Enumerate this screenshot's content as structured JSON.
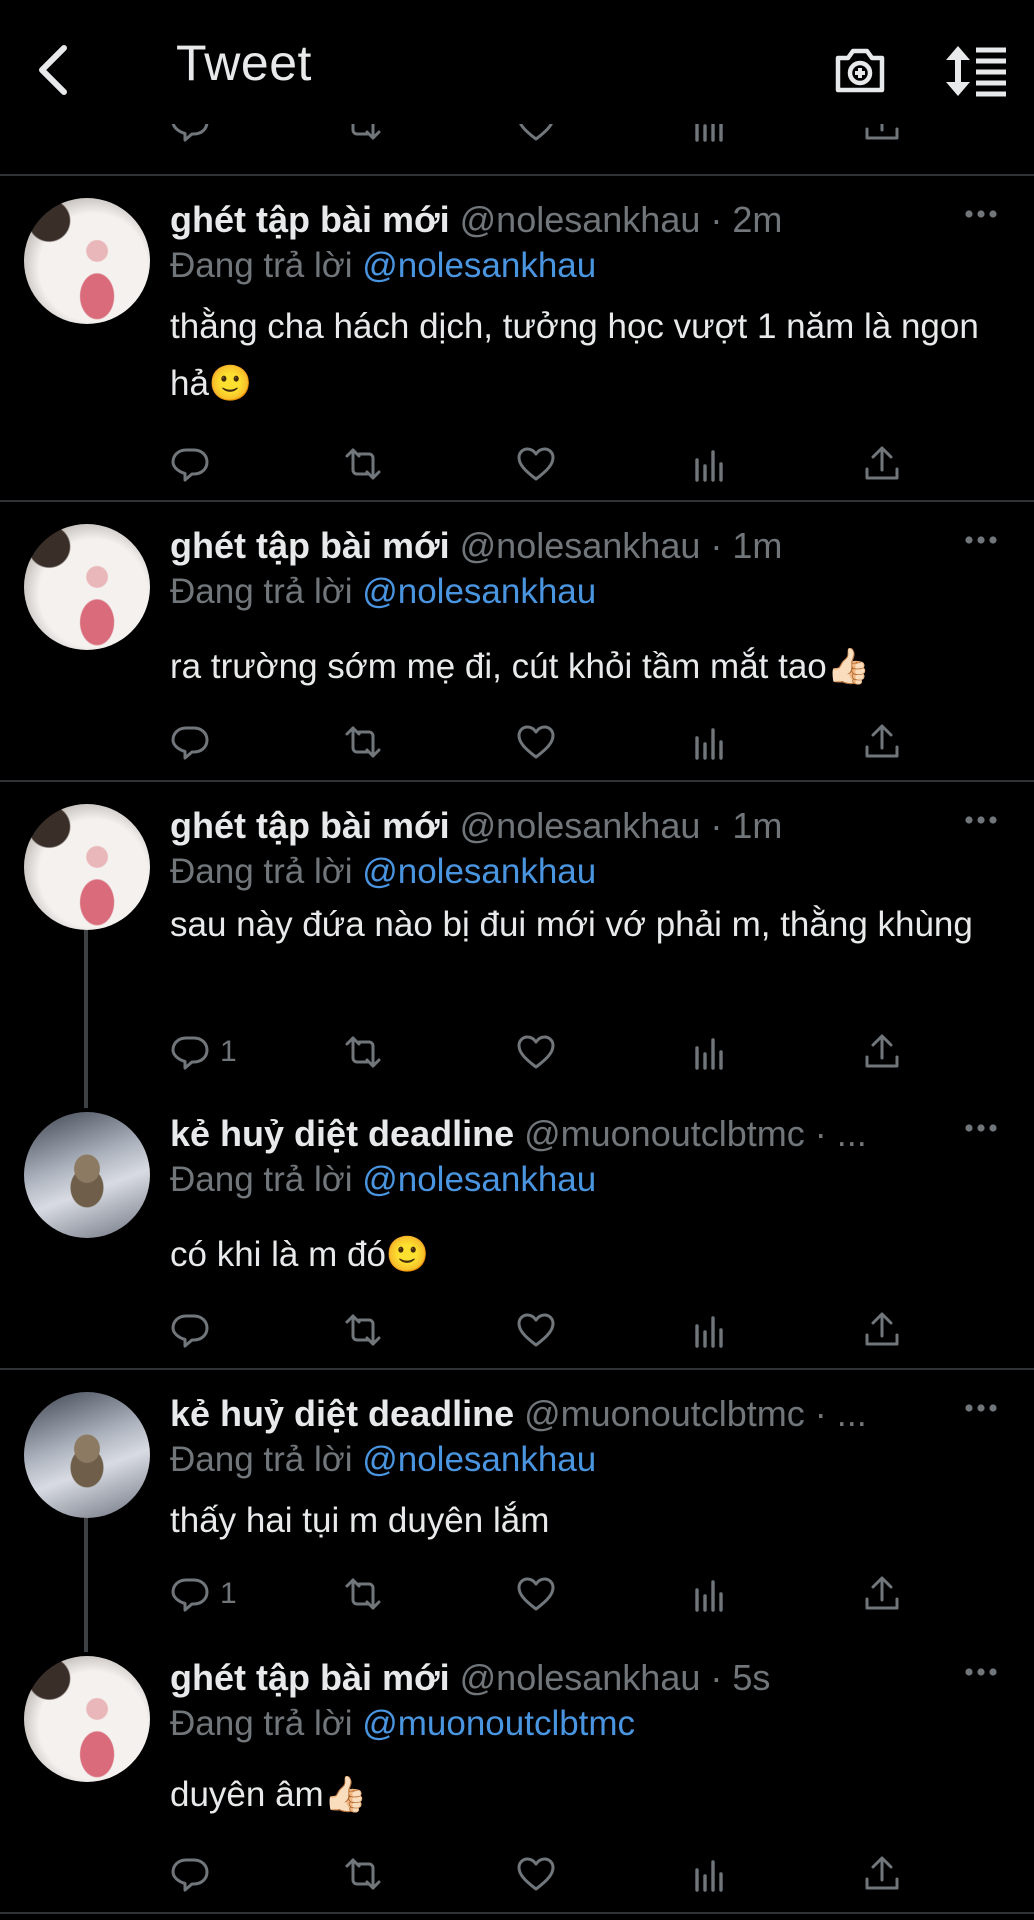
{
  "header": {
    "title": "Tweet"
  },
  "tweets": [
    {
      "name": "ghét tập bài mới",
      "meta": "@nolesankhau · 2m",
      "reply_prefix": "Đang trả lời",
      "reply_to": "@nolesankhau",
      "text": "thằng cha hách dịch, tưởng học vượt 1 năm là ngon hả🙂",
      "reply_count": ""
    },
    {
      "name": "ghét tập bài mới",
      "meta": "@nolesankhau · 1m",
      "reply_prefix": "Đang trả lời",
      "reply_to": "@nolesankhau",
      "text": "ra trường sớm mẹ đi, cút khỏi tầm mắt tao👍🏻",
      "reply_count": ""
    },
    {
      "name": "ghét tập bài mới",
      "meta": "@nolesankhau · 1m",
      "reply_prefix": "Đang trả lời",
      "reply_to": "@nolesankhau",
      "text": "sau này đứa nào bị đui mới vớ phải m, thằng khùng",
      "reply_count": "1"
    },
    {
      "name": "kẻ huỷ diệt deadline",
      "meta": "@muonoutclbtmc · ...",
      "reply_prefix": "Đang trả lời",
      "reply_to": "@nolesankhau",
      "text": "có khi là m đó🙂",
      "reply_count": ""
    },
    {
      "name": "kẻ huỷ diệt deadline",
      "meta": "@muonoutclbtmc · ...",
      "reply_prefix": "Đang trả lời",
      "reply_to": "@nolesankhau",
      "text": "thấy hai tụi m duyên lắm",
      "reply_count": "1"
    },
    {
      "name": "ghét tập bài mới",
      "meta": "@nolesankhau · 5s",
      "reply_prefix": "Đang trả lời",
      "reply_to": "@muonoutclbtmc",
      "text": "duyên âm👍🏻",
      "reply_count": ""
    }
  ],
  "colors": {
    "background": "#000000",
    "text": "#e7e9ea",
    "secondary": "#71767b",
    "mention": "#4a95e0",
    "divider": "#2f3336"
  },
  "icons": [
    "back-arrow-icon",
    "add-photo-icon",
    "sort-icon",
    "reply-icon",
    "retweet-icon",
    "like-icon",
    "analytics-icon",
    "share-icon",
    "more-icon"
  ]
}
